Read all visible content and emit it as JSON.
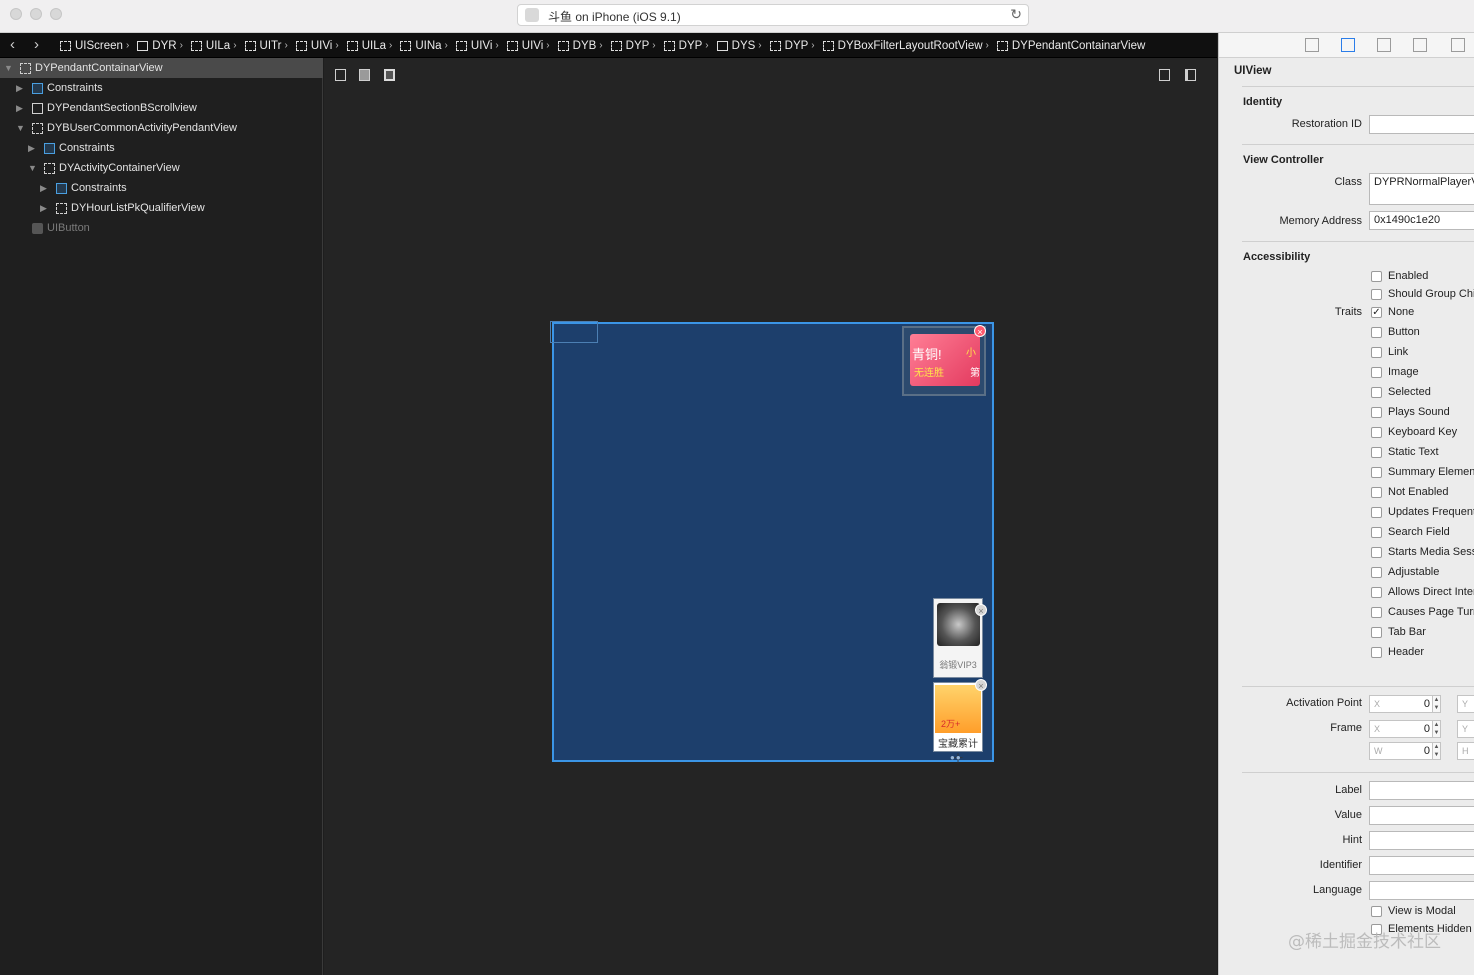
{
  "window": {
    "title": "斗鱼 on iPhone (iOS 9.1)"
  },
  "breadcrumbs": [
    {
      "label": "UIScreen",
      "icon": "view-icon"
    },
    {
      "label": "DYR",
      "icon": "window-icon"
    },
    {
      "label": "UILa",
      "icon": "view-icon"
    },
    {
      "label": "UITr",
      "icon": "view-icon"
    },
    {
      "label": "UIVi",
      "icon": "view-icon"
    },
    {
      "label": "UILa",
      "icon": "view-icon"
    },
    {
      "label": "UINa",
      "icon": "view-icon"
    },
    {
      "label": "UIVi",
      "icon": "view-icon"
    },
    {
      "label": "UIVi",
      "icon": "view-icon"
    },
    {
      "label": "DYB",
      "icon": "view-icon"
    },
    {
      "label": "DYP",
      "icon": "view-icon"
    },
    {
      "label": "DYP",
      "icon": "view-icon"
    },
    {
      "label": "DYS",
      "icon": "scroll-icon"
    },
    {
      "label": "DYP",
      "icon": "view-icon"
    },
    {
      "label": "DYBoxFilterLayoutRootView",
      "icon": "view-icon"
    },
    {
      "label": "DYPendantContainarView",
      "icon": "view-icon"
    }
  ],
  "navigator": {
    "rows": [
      {
        "label": "DYPendantContainarView",
        "indent": 0,
        "icon": "view-icon",
        "expanded": true,
        "selected": true
      },
      {
        "label": "Constraints",
        "indent": 1,
        "icon": "constraint-icon",
        "expanded": false
      },
      {
        "label": "DYPendantSectionBScrollview",
        "indent": 1,
        "icon": "scroll-icon",
        "expanded": false
      },
      {
        "label": "DYBUserCommonActivityPendantView",
        "indent": 1,
        "icon": "view-icon",
        "expanded": true
      },
      {
        "label": "Constraints",
        "indent": 2,
        "icon": "constraint-icon",
        "expanded": false
      },
      {
        "label": "DYActivityContainerView",
        "indent": 2,
        "icon": "view-icon",
        "expanded": true
      },
      {
        "label": "Constraints",
        "indent": 3,
        "icon": "constraint-icon",
        "expanded": false
      },
      {
        "label": "DYHourListPkQualifierView",
        "indent": 3,
        "icon": "view-icon",
        "expanded": false
      },
      {
        "label": "UIButton",
        "indent": 1,
        "icon": "button-icon",
        "dim": true
      }
    ]
  },
  "canvas": {
    "pendant_top": {
      "line1": "青铜!",
      "line2": "无连胜",
      "right1": "小",
      "right2": "第"
    },
    "pendant_mid": {
      "label": "翁锻VIP3"
    },
    "pendant_bottom": {
      "amount": "2万+",
      "label": "宝藏累计十"
    }
  },
  "inspector": {
    "header": "UIView",
    "identity": {
      "title": "Identity",
      "restoration_id_label": "Restoration ID",
      "restoration_id_value": ""
    },
    "view_controller": {
      "title": "View Controller",
      "class_label": "Class",
      "class_value": "DYPRNormalPlayerViewController",
      "memory_label": "Memory Address",
      "memory_value": "0x1490c1e20"
    },
    "accessibility": {
      "title": "Accessibility",
      "enabled": "Enabled",
      "should_group": "Should Group Children",
      "traits_label": "Traits",
      "traits": [
        {
          "label": "None",
          "checked": true
        },
        {
          "label": "Button",
          "checked": false
        },
        {
          "label": "Link",
          "checked": false
        },
        {
          "label": "Image",
          "checked": false
        },
        {
          "label": "Selected",
          "checked": false
        },
        {
          "label": "Plays Sound",
          "checked": false
        },
        {
          "label": "Keyboard Key",
          "checked": false
        },
        {
          "label": "Static Text",
          "checked": false
        },
        {
          "label": "Summary Element",
          "checked": false
        },
        {
          "label": "Not Enabled",
          "checked": false
        },
        {
          "label": "Updates Frequently",
          "checked": false
        },
        {
          "label": "Search Field",
          "checked": false
        },
        {
          "label": "Starts Media Session",
          "checked": false
        },
        {
          "label": "Adjustable",
          "checked": false
        },
        {
          "label": "Allows Direct Interaction",
          "checked": false
        },
        {
          "label": "Causes Page Turn",
          "checked": false
        },
        {
          "label": "Tab Bar",
          "checked": false
        },
        {
          "label": "Header",
          "checked": false
        }
      ]
    },
    "geometry": {
      "activation_point_label": "Activation Point",
      "frame_label": "Frame",
      "x_placeholder": "X",
      "y_placeholder": "Y",
      "w_placeholder": "W",
      "h_placeholder": "H",
      "activation_x": "0",
      "frame_x": "0",
      "frame_w": "0"
    },
    "labels": {
      "label": "Label",
      "value": "Value",
      "hint": "Hint",
      "identifier": "Identifier",
      "language": "Language"
    },
    "modal": {
      "view_is_modal": "View is Modal",
      "elements_hidden": "Elements Hidden"
    },
    "watermark": "@稀土掘金技术社区"
  }
}
